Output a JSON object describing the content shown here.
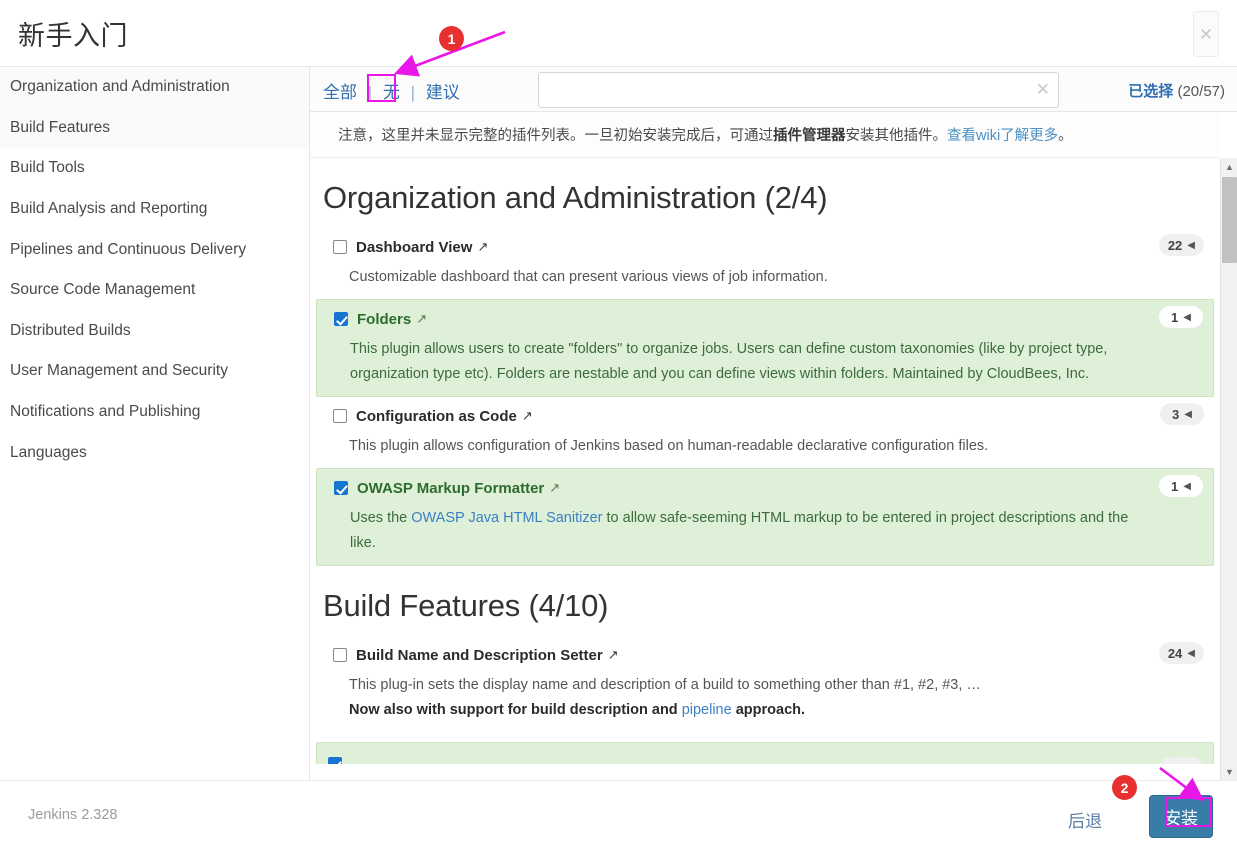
{
  "window": {
    "title": "新手入门",
    "close_icon": "close-icon"
  },
  "sidebar": {
    "items": [
      {
        "label": "Organization and Administration",
        "shaded": true
      },
      {
        "label": "Build Features",
        "shaded": true
      },
      {
        "label": "Build Tools",
        "shaded": false
      },
      {
        "label": "Build Analysis and Reporting",
        "shaded": false
      },
      {
        "label": "Pipelines and Continuous Delivery",
        "shaded": false
      },
      {
        "label": "Source Code Management",
        "shaded": false
      },
      {
        "label": "Distributed Builds",
        "shaded": false
      },
      {
        "label": "User Management and Security",
        "shaded": false
      },
      {
        "label": "Notifications and Publishing",
        "shaded": false
      },
      {
        "label": "Languages",
        "shaded": false
      }
    ]
  },
  "toolbar": {
    "tab_all": "全部",
    "tab_none": "无",
    "tab_suggested": "建议",
    "separator": "|",
    "search_value": "",
    "search_placeholder": "",
    "search_clear_icon": "clear-x-icon",
    "selected_label": "已选择",
    "selected_count": "(20/57)"
  },
  "notice": {
    "part1": "注意，这里并未显示完整的插件列表。一旦初始安装完成后，可通过",
    "bold1": "插件管理器",
    "part2": "安装其他插件。",
    "link": "查看wiki了解更多",
    "part3": "。"
  },
  "sections": [
    {
      "heading": "Organization and Administration (2/4)",
      "plugins": [
        {
          "name": "Dashboard View",
          "checked": false,
          "badge": "22",
          "desc": "Customizable dashboard that can present various views of job information."
        },
        {
          "name": "Folders",
          "checked": true,
          "badge": "1",
          "desc": "This plugin allows users to create \"folders\" to organize jobs. Users can define custom taxonomies (like by project type, organization type etc). Folders are nestable and you can define views within folders. Maintained by CloudBees, Inc."
        },
        {
          "name": "Configuration as Code",
          "checked": false,
          "badge": "3",
          "desc": "This plugin allows configuration of Jenkins based on human-readable declarative configuration files."
        },
        {
          "name": "OWASP Markup Formatter",
          "checked": true,
          "badge": "1",
          "desc_pre": "Uses the ",
          "desc_link": "OWASP Java HTML Sanitizer",
          "desc_post": " to allow safe-seeming HTML markup to be entered in project descriptions and the like."
        }
      ]
    },
    {
      "heading": "Build Features (4/10)",
      "plugins": [
        {
          "name": "Build Name and Description Setter",
          "checked": false,
          "badge": "24",
          "desc_line1": "This plug-in sets the display name and description of a build to something other than #1, #2, #3, …",
          "desc_bold_pre": "Now also with support for build description and ",
          "desc_bold_link": "pipeline",
          "desc_bold_post": " approach."
        }
      ]
    }
  ],
  "badge_arrow_glyph": "◀",
  "external_link_glyph": "↗",
  "scrollbar": {
    "up_arrow": "▲",
    "down_arrow": "▼"
  },
  "footer": {
    "version": "Jenkins 2.328",
    "back_label": "后退",
    "install_label": "安装"
  },
  "annotations": [
    {
      "number": "1"
    },
    {
      "number": "2"
    }
  ],
  "colors": {
    "accent_blue": "#2f6fb0",
    "selected_row_green": "#dff0d8",
    "checkbox_blue": "#1675d1",
    "install_button": "#3a7ca8",
    "annotation_magenta": "#e817e8",
    "annotation_red": "#e83030"
  }
}
